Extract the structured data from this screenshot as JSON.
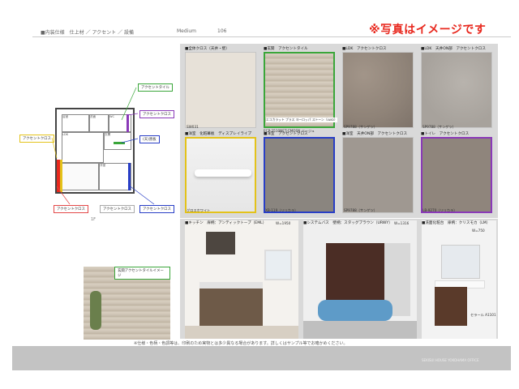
{
  "header": {
    "title": "■内装仕様　仕上材 ／ アクセント ／ 設備",
    "type": "Medium",
    "number": "106",
    "banner": "※写真はイメージです"
  },
  "floorplan": {
    "callouts": {
      "accent_tile": "アクセントタイル",
      "accent_cloth_top": "アクセントクロス",
      "genkan": "(天)黒板",
      "accent_left": "アクセントクロス",
      "accent_b1": "アクセントクロス",
      "accent_b2": "アクセントクロス",
      "accent_b3": "アクセントクロス"
    },
    "rooms": {
      "bath": "浴室",
      "wash": "洗面",
      "ldk": "LDK",
      "western": "洋室",
      "toilet": "WC",
      "genkan": "玄関"
    },
    "scale": "1F",
    "tile_image_label": "玄関アクセントタイルイメージ"
  },
  "swatches": [
    {
      "label": "■全体クロス（天井・壁）",
      "caption": "SW031",
      "texture": "wall",
      "border": "gray"
    },
    {
      "label": "■玄関　アクセントタイル",
      "caption": "ECP-2510NET-CMOSN ベージュ",
      "texture": "tile",
      "border": "green",
      "inner_label": "エコカラット プラス ヨーロッパ ストーン（LWD）"
    },
    {
      "label": "■LDK　アクセントクロス",
      "caption": "SP9788（サンゲツ）",
      "texture": "stone",
      "border": "gray"
    },
    {
      "label": "■LDK　天井ON部　アクセントクロス",
      "caption": "SP9788（サンゲツ）",
      "texture": "stone2",
      "border": "gray"
    },
    {
      "label": "■洋室　化粧幕板　ディスプレイライプ",
      "caption": "グロスホワイト",
      "texture": "ww",
      "border": "yellow"
    },
    {
      "label": "■洋室　アクセントクロス",
      "caption": "XB-119（リリカラ）",
      "texture": "grey1",
      "border": "blue"
    },
    {
      "label": "■洋室　天井ON部　アクセントクロス",
      "caption": "SP9788（サンゲツ）",
      "texture": "grey2",
      "border": "gray"
    },
    {
      "label": "■トイレ　アクセントクロス",
      "caption": "LB-9270（リリカラ）",
      "texture": "grey3",
      "border": "purple"
    }
  ],
  "photos": [
    {
      "label": "■キッチン　扉柄：アンティックトープ（EML）",
      "caption": "W=1950"
    },
    {
      "label": "■システムバス　壁柄：スタッグブラウン（URWY）",
      "caption": "W=1316"
    },
    {
      "label": "■洗面化粧台　扉柄：クリスモカ（LM）",
      "caption": "W=750",
      "sub": "セラール A1101"
    }
  ],
  "footnote": "※仕様・色柄・色調等は、印刷のため実物とは多少異なる場合があります。詳しくはサンプル等でお確かめください。",
  "footer": "SEKISUI HOUSE YOKOHAMA OFFICE"
}
